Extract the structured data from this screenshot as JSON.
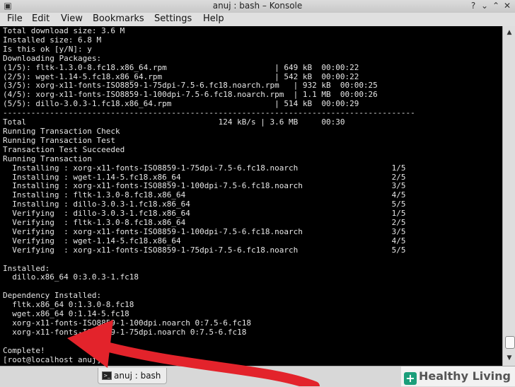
{
  "window": {
    "title": "anuj : bash – Konsole",
    "controls": [
      "help-icon",
      "minimize-icon",
      "maximize-icon",
      "close-icon"
    ]
  },
  "menu": [
    "File",
    "Edit",
    "View",
    "Bookmarks",
    "Settings",
    "Help"
  ],
  "terminal": {
    "lines": [
      "Total download size: 3.6 M",
      "Installed size: 6.8 M",
      "Is this ok [y/N]: y",
      "Downloading Packages:",
      "(1/5): fltk-1.3.0-8.fc18.x86_64.rpm                       | 649 kB  00:00:22",
      "(2/5): wget-1.14-5.fc18.x86_64.rpm                        | 542 kB  00:00:22",
      "(3/5): xorg-x11-fonts-ISO8859-1-75dpi-7.5-6.fc18.noarch.rpm   | 932 kB  00:00:25",
      "(4/5): xorg-x11-fonts-ISO8859-1-100dpi-7.5-6.fc18.noarch.rpm  | 1.1 MB  00:00:26",
      "(5/5): dillo-3.0.3-1.fc18.x86_64.rpm                      | 514 kB  00:00:29",
      "----------------------------------------------------------------------------------------",
      "Total                                         124 kB/s | 3.6 MB     00:30",
      "Running Transaction Check",
      "Running Transaction Test",
      "Transaction Test Succeeded",
      "Running Transaction",
      "  Installing : xorg-x11-fonts-ISO8859-1-75dpi-7.5-6.fc18.noarch                    1/5",
      "  Installing : wget-1.14-5.fc18.x86_64                                             2/5",
      "  Installing : xorg-x11-fonts-ISO8859-1-100dpi-7.5-6.fc18.noarch                   3/5",
      "  Installing : fltk-1.3.0-8.fc18.x86_64                                            4/5",
      "  Installing : dillo-3.0.3-1.fc18.x86_64                                           5/5",
      "  Verifying  : dillo-3.0.3-1.fc18.x86_64                                           1/5",
      "  Verifying  : fltk-1.3.0-8.fc18.x86_64                                            2/5",
      "  Verifying  : xorg-x11-fonts-ISO8859-1-100dpi-7.5-6.fc18.noarch                   3/5",
      "  Verifying  : wget-1.14-5.fc18.x86_64                                             4/5",
      "  Verifying  : xorg-x11-fonts-ISO8859-1-75dpi-7.5-6.fc18.noarch                    5/5",
      "",
      "Installed:",
      "  dillo.x86_64 0:3.0.3-1.fc18",
      "",
      "Dependency Installed:",
      "  fltk.x86_64 0:1.3.0-8.fc18",
      "  wget.x86_64 0:1.14-5.fc18",
      "  xorg-x11-fonts-ISO8859-1-100dpi.noarch 0:7.5-6.fc18",
      "  xorg-x11-fonts-ISO8859-1-75dpi.noarch 0:7.5-6.fc18",
      "",
      "Complete!",
      "[root@localhost anuj]# "
    ]
  },
  "tab": {
    "label": "anuj : bash"
  },
  "watermark": {
    "text": "Healthy Living"
  },
  "colors": {
    "terminal_bg": "#000000",
    "terminal_fg": "#e6e6e6",
    "arrow": "#e3232b"
  }
}
